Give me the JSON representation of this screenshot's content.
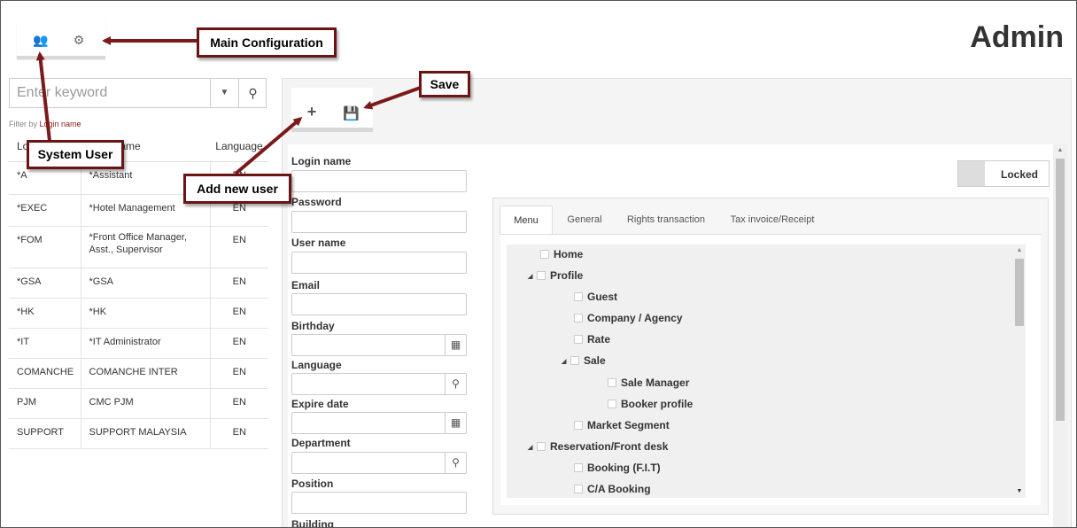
{
  "header": {
    "title": "Admin"
  },
  "main_config": {
    "icons": [
      "users-icon",
      "gears-icon"
    ]
  },
  "search": {
    "placeholder": "Enter keyword",
    "filter_prefix": "Filter by ",
    "filter_field": "Login name"
  },
  "user_table": {
    "headers": [
      "Login name",
      "User name",
      "Language"
    ],
    "rows": [
      [
        "*A",
        "*Assistant",
        "EN"
      ],
      [
        "*EXEC",
        "*Hotel Management",
        "EN"
      ],
      [
        "*FOM",
        "*Front Office Manager, Asst., Supervisor",
        "EN"
      ],
      [
        "*GSA",
        "*GSA",
        "EN"
      ],
      [
        "*HK",
        "*HK",
        "EN"
      ],
      [
        "*IT",
        "*IT Administrator",
        "EN"
      ],
      [
        "COMANCHE",
        "COMANCHE INTER",
        "EN"
      ],
      [
        "PJM",
        "CMC PJM",
        "EN"
      ],
      [
        "SUPPORT",
        "SUPPORT MALAYSIA",
        "EN"
      ]
    ]
  },
  "form": {
    "fields": {
      "login_name": "Login name",
      "password": "Password",
      "user_name": "User name",
      "email": "Email",
      "birthday": "Birthday",
      "language": "Language",
      "expire_date": "Expire date",
      "department": "Department",
      "position": "Position",
      "building": "Building"
    },
    "locked_label": "Locked"
  },
  "tabs": [
    "Menu",
    "General",
    "Rights transaction",
    "Tax invoice/Receipt"
  ],
  "menu_tree": [
    "Home",
    "Profile",
    "Guest",
    "Company / Agency",
    "Rate",
    "Sale",
    "Sale Manager",
    "Booker profile",
    "Market Segment",
    "Reservation/Front desk",
    "Booking (F.I.T)",
    "C/A Booking"
  ],
  "callouts": {
    "main_configuration": "Main Configuration",
    "system_user": "System User",
    "save": "Save",
    "add_new_user": "Add new user"
  },
  "colors": {
    "callout_border": "#6b1414",
    "arrow": "#7a1a1a"
  }
}
